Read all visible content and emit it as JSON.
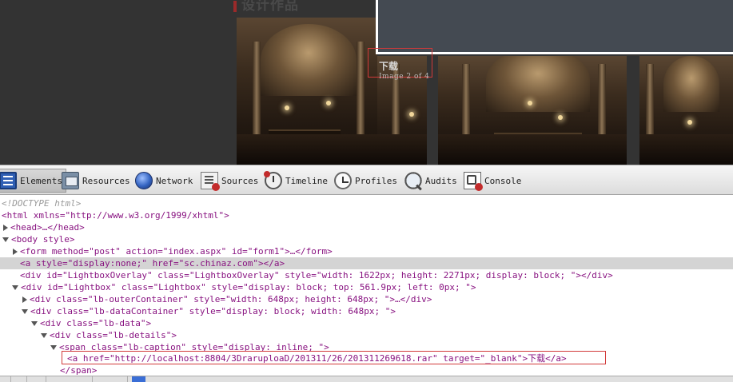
{
  "page": {
    "heading": "设计作品",
    "lightbox_caption": "下载",
    "lightbox_count": "Image 2 of 4"
  },
  "devtools": {
    "tabs": [
      {
        "label": "Elements",
        "icon": "elements-icon",
        "active": true
      },
      {
        "label": "Resources",
        "icon": "resources-icon"
      },
      {
        "label": "Network",
        "icon": "network-icon"
      },
      {
        "label": "Sources",
        "icon": "sources-icon"
      },
      {
        "label": "Timeline",
        "icon": "timeline-icon"
      },
      {
        "label": "Profiles",
        "icon": "profiles-icon"
      },
      {
        "label": "Audits",
        "icon": "audits-icon"
      },
      {
        "label": "Console",
        "icon": "console-icon"
      }
    ],
    "tree": {
      "doctype": "<!DOCTYPE html>",
      "html_open": "<html xmlns=\"http://www.w3.org/1999/xhtml\">",
      "head": "<head>…</head>",
      "body_open": "<body style>",
      "form": "<form method=\"post\" action=\"index.aspx\" id=\"form1\">…</form>",
      "anchor_hidden": "<a style=\"display:none;\" href=\"sc.chinaz.com\"></a>",
      "overlay": "<div id=\"LightboxOverlay\" class=\"LightboxOverlay\" style=\"width: 1622px; height: 2271px; display: block; \"></div>",
      "lightbox": "<div id=\"Lightbox\" class=\"Lightbox\" style=\"display: block; top: 561.9px; left: 0px; \">",
      "outer_container": "<div class=\"lb-outerContainer\" style=\"width: 648px; height: 648px; \">…</div>",
      "data_container": "<div class=\"lb-dataContainer\" style=\"display: block; width: 648px; \">",
      "lb_data": "<div class=\"lb-data\">",
      "lb_details": "<div class=\"lb-details\">",
      "caption_span": "<span class=\"lb-caption\" style=\"display: inline; \">",
      "download_link": "<a href=\"http://localhost:8804/3DraruploaD/201311/26/201311269618.rar\" target=\"_blank\">下载</a>",
      "span_close": "</span>"
    }
  }
}
